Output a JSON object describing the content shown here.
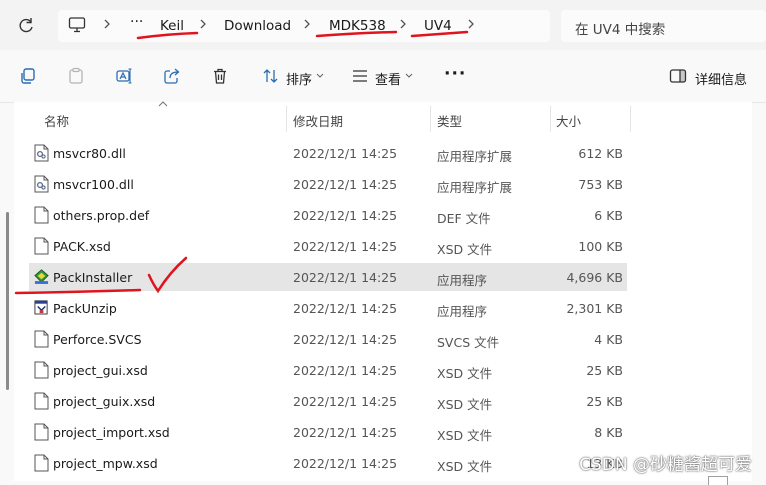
{
  "address_bar": {
    "more": "···",
    "breadcrumbs": [
      "Keil",
      "Download",
      "MDK538",
      "UV4"
    ],
    "search_placeholder": "在 UV4 中搜索"
  },
  "toolbar": {
    "sort_label": "排序",
    "view_label": "查看",
    "more": "···",
    "details_label": "详细信息"
  },
  "columns": {
    "name": "名称",
    "date": "修改日期",
    "type": "类型",
    "size": "大小"
  },
  "files": [
    {
      "name": "msvcr80.dll",
      "date": "2022/12/1 14:25",
      "type": "应用程序扩展",
      "size": "612 KB",
      "icon": "dll-file-icon"
    },
    {
      "name": "msvcr100.dll",
      "date": "2022/12/1 14:25",
      "type": "应用程序扩展",
      "size": "753 KB",
      "icon": "dll-file-icon"
    },
    {
      "name": "others.prop.def",
      "date": "2022/12/1 14:25",
      "type": "DEF 文件",
      "size": "6 KB",
      "icon": "blank-file-icon"
    },
    {
      "name": "PACK.xsd",
      "date": "2022/12/1 14:25",
      "type": "XSD 文件",
      "size": "100 KB",
      "icon": "blank-file-icon"
    },
    {
      "name": "PackInstaller",
      "date": "2022/12/1 14:25",
      "type": "应用程序",
      "size": "4,696 KB",
      "icon": "pack-installer-icon",
      "selected": true
    },
    {
      "name": "PackUnzip",
      "date": "2022/12/1 14:25",
      "type": "应用程序",
      "size": "2,301 KB",
      "icon": "pack-unzip-icon"
    },
    {
      "name": "Perforce.SVCS",
      "date": "2022/12/1 14:25",
      "type": "SVCS 文件",
      "size": "4 KB",
      "icon": "blank-file-icon"
    },
    {
      "name": "project_gui.xsd",
      "date": "2022/12/1 14:25",
      "type": "XSD 文件",
      "size": "25 KB",
      "icon": "blank-file-icon"
    },
    {
      "name": "project_guix.xsd",
      "date": "2022/12/1 14:25",
      "type": "XSD 文件",
      "size": "25 KB",
      "icon": "blank-file-icon"
    },
    {
      "name": "project_import.xsd",
      "date": "2022/12/1 14:25",
      "type": "XSD 文件",
      "size": "8 KB",
      "icon": "blank-file-icon"
    },
    {
      "name": "project_mpw.xsd",
      "date": "2022/12/1 14:25",
      "type": "XSD 文件",
      "size": "13 KB",
      "icon": "blank-file-icon"
    }
  ],
  "watermark": "CSDN @砂糖酱超可爱",
  "colors": {
    "annotation": "#e0141e",
    "selection": "#e5e5e5",
    "accent": "#0067c0"
  }
}
